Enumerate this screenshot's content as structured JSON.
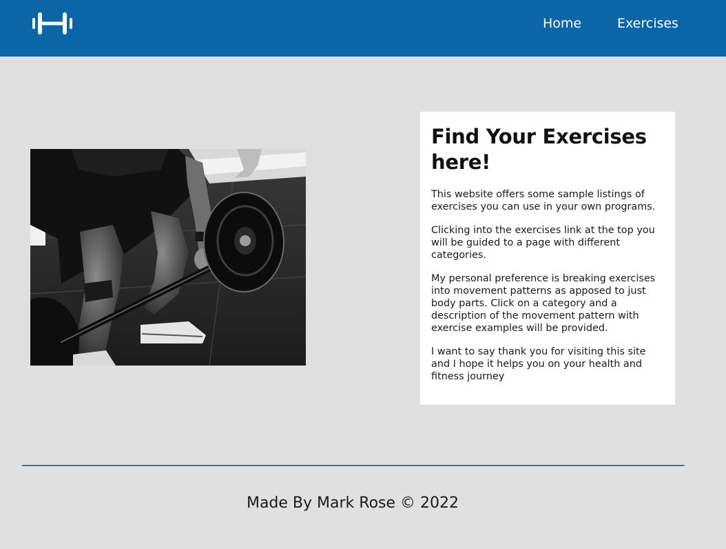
{
  "nav": {
    "logo_icon": "dumbbell-icon",
    "links": [
      {
        "label": "Home"
      },
      {
        "label": "Exercises"
      }
    ]
  },
  "hero": {
    "image": "black-and-white photo of a person gripping a loaded barbell for a deadlift"
  },
  "info": {
    "title": "Find Your Exercises here!",
    "paragraphs": [
      "This website offers some sample listings of exercises you can use in your own programs.",
      "Clicking into the exercises link at the top you will be guided to a page with different categories.",
      "My personal preference is breaking exercises into movement patterns as apposed to just body parts. Click on a category and a description of the movement pattern with exercise examples will be provided.",
      "I want to say thank you for visiting this site and I hope it helps you on your health and fitness journey"
    ]
  },
  "footer": {
    "text": "Made By Mark Rose © 2022"
  },
  "colors": {
    "navbar": "#0a66a6",
    "page_background": "#e1e0e0",
    "card_background": "#ffffff",
    "divider": "#406a8c"
  }
}
